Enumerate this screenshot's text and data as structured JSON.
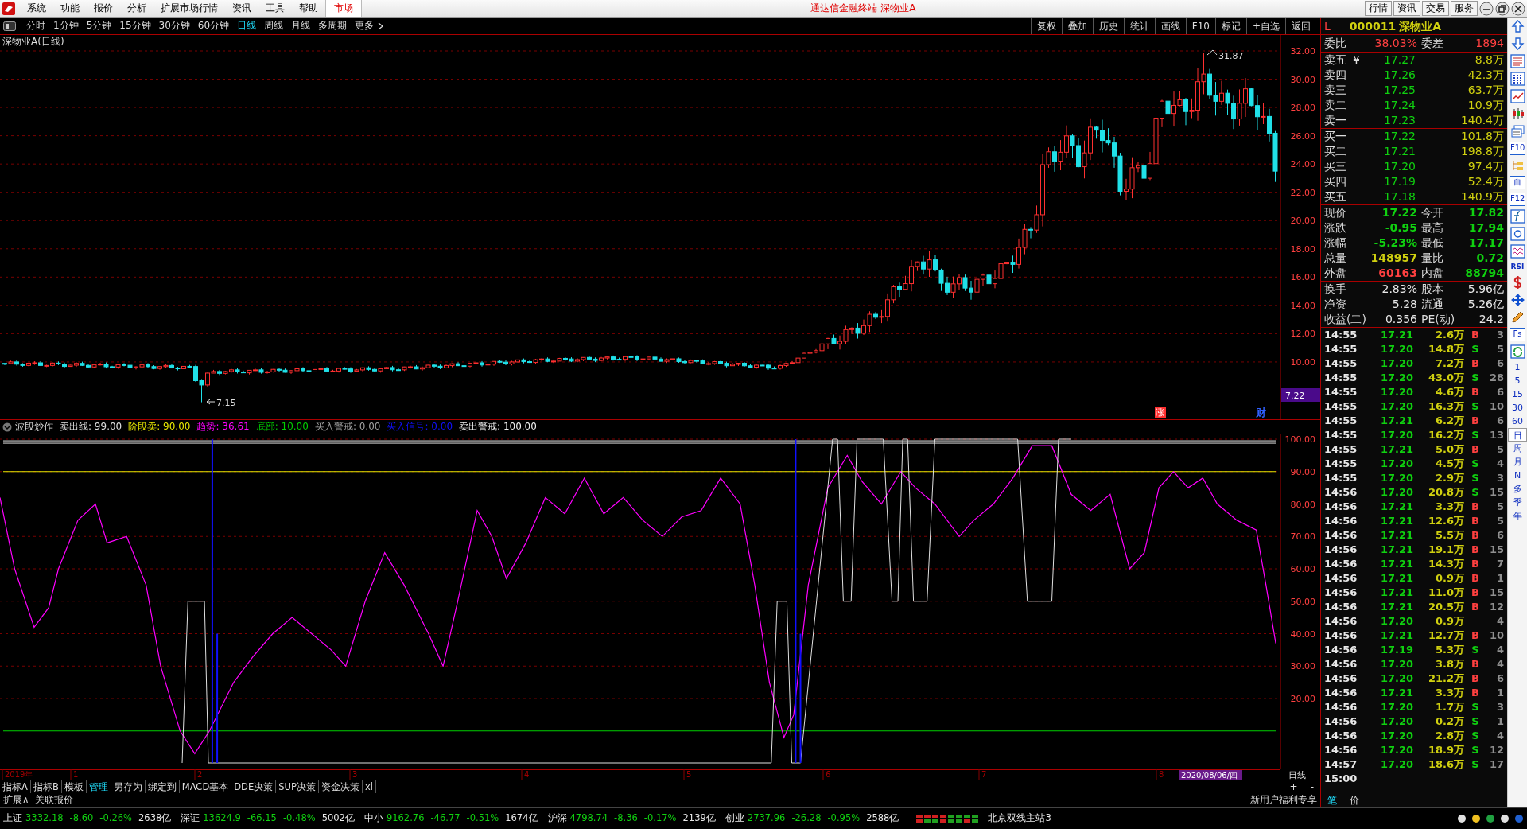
{
  "menu": [
    "系统",
    "功能",
    "报价",
    "分析",
    "扩展市场行情",
    "资讯",
    "工具",
    "帮助"
  ],
  "market_tab": "市场",
  "window_title": "通达信金融终端  深物业A",
  "top_buttons": [
    "行情",
    "资讯",
    "交易",
    "服务"
  ],
  "periods": [
    {
      "label": "分时",
      "selected": false
    },
    {
      "label": "1分钟",
      "selected": false
    },
    {
      "label": "5分钟",
      "selected": false
    },
    {
      "label": "15分钟",
      "selected": false
    },
    {
      "label": "30分钟",
      "selected": false
    },
    {
      "label": "60分钟",
      "selected": false
    },
    {
      "label": "日线",
      "selected": true
    },
    {
      "label": "周线",
      "selected": false
    },
    {
      "label": "月线",
      "selected": false
    },
    {
      "label": "多周期",
      "selected": false
    },
    {
      "label": "更多",
      "selected": false
    }
  ],
  "chart_tools": [
    "复权",
    "叠加",
    "历史",
    "统计",
    "画线",
    "F10",
    "标记",
    "+自选",
    "返回"
  ],
  "chart_title": "深物业A(日线)",
  "price_axis": [
    "32.00",
    "30.00",
    "28.00",
    "26.00",
    "24.00",
    "22.00",
    "20.00",
    "18.00",
    "16.00",
    "14.00",
    "12.00",
    "10.00"
  ],
  "high_label": "31.87",
  "low_label": "7.15",
  "price_tag": "7.22",
  "chart_markers": [
    {
      "text": "涨",
      "color": "#ff3030"
    },
    {
      "text": "财",
      "color": "#3060ff"
    }
  ],
  "indicator": {
    "name": "波段炒作",
    "params": [
      {
        "label": "卖出线:",
        "value": "99.00",
        "color": "#e0e0e0"
      },
      {
        "label": "阶段卖:",
        "value": "90.00",
        "color": "#e8e800"
      },
      {
        "label": "趋势:",
        "value": "36.61",
        "color": "#ff00ff"
      },
      {
        "label": "底部:",
        "value": "10.00",
        "color": "#00d000"
      },
      {
        "label": "买入警戒:",
        "value": "0.00",
        "color": "#a0a0a0"
      },
      {
        "label": "买入信号:",
        "value": "0.00",
        "color": "#1010ff"
      },
      {
        "label": "卖出警戒:",
        "value": "100.00",
        "color": "#f0f0f0"
      }
    ],
    "axis": [
      "100.00",
      "90.00",
      "80.00",
      "70.00",
      "60.00",
      "50.00",
      "40.00",
      "30.00",
      "20.00"
    ]
  },
  "time_axis": {
    "labels": [
      "2019年",
      "1",
      "2",
      "3",
      "4",
      "5",
      "6",
      "7",
      "8"
    ],
    "date": "2020/08/06/四",
    "period": "日线"
  },
  "bottom_tabs": [
    {
      "label": "指标A",
      "selected": false
    },
    {
      "label": "指标B",
      "selected": false
    },
    {
      "label": "模板",
      "selected": false
    },
    {
      "label": "管理",
      "selected": true
    },
    {
      "label": "另存为",
      "selected": false
    },
    {
      "label": "绑定到",
      "selected": false
    },
    {
      "label": "MACD基本",
      "selected": false
    },
    {
      "label": "DDE决策",
      "selected": false
    },
    {
      "label": "SUP决策",
      "selected": false
    },
    {
      "label": "资金决策",
      "selected": false
    },
    {
      "label": "xl",
      "selected": false
    }
  ],
  "zoom_buttons": [
    "+",
    "-"
  ],
  "extra_links": [
    "扩展∧",
    "关联报价"
  ],
  "promo": "新用户福利专享",
  "detail_tabs": [
    {
      "label": "笔",
      "selected": true
    },
    {
      "label": "价",
      "selected": false
    }
  ],
  "quote": {
    "prefix": "L",
    "code": "000011",
    "name": "深物业A",
    "ratio": {
      "label": "委比",
      "value": "38.03%",
      "label2": "委差",
      "value2": "1894"
    },
    "asks": [
      {
        "label": "卖五",
        "currency": "¥",
        "price": "17.27",
        "volume": "8.8万"
      },
      {
        "label": "卖四",
        "price": "17.26",
        "volume": "42.3万"
      },
      {
        "label": "卖三",
        "price": "17.25",
        "volume": "63.7万"
      },
      {
        "label": "卖二",
        "price": "17.24",
        "volume": "10.9万"
      },
      {
        "label": "卖一",
        "price": "17.23",
        "volume": "140.4万"
      }
    ],
    "bids": [
      {
        "label": "买一",
        "price": "17.22",
        "volume": "101.8万"
      },
      {
        "label": "买二",
        "price": "17.21",
        "volume": "198.8万"
      },
      {
        "label": "买三",
        "price": "17.20",
        "volume": "97.4万"
      },
      {
        "label": "买四",
        "price": "17.19",
        "volume": "52.4万"
      },
      {
        "label": "买五",
        "price": "17.18",
        "volume": "140.9万"
      }
    ],
    "stats": [
      {
        "cells": [
          {
            "label": "现价",
            "value": "17.22",
            "color": "#10d010"
          },
          {
            "label": "今开",
            "value": "17.82",
            "color": "#10d010"
          }
        ]
      },
      {
        "cells": [
          {
            "label": "涨跌",
            "value": "-0.95",
            "color": "#10d010"
          },
          {
            "label": "最高",
            "value": "17.94",
            "color": "#10d010"
          }
        ]
      },
      {
        "cells": [
          {
            "label": "涨幅",
            "value": "-5.23%",
            "color": "#10d010"
          },
          {
            "label": "最低",
            "value": "17.17",
            "color": "#10d010"
          }
        ]
      },
      {
        "cells": [
          {
            "label": "总量",
            "value": "148957",
            "color": "#d0d010"
          },
          {
            "label": "量比",
            "value": "0.72",
            "color": "#10d010"
          }
        ]
      },
      {
        "cells": [
          {
            "label": "外盘",
            "value": "60163",
            "color": "#ff4040"
          },
          {
            "label": "内盘",
            "value": "88794",
            "color": "#10d010"
          }
        ]
      }
    ],
    "finance": [
      {
        "label": "换手",
        "value": "2.83%",
        "label2": "股本",
        "value2": "5.96亿"
      },
      {
        "label": "净资",
        "value": "5.28",
        "label2": "流通",
        "value2": "5.26亿"
      },
      {
        "label": "收益(二)",
        "value": "0.356",
        "label2": "PE(动)",
        "value2": "24.2"
      }
    ]
  },
  "trades": [
    {
      "time": "14:55",
      "price": "17.21",
      "volume": "2.6万",
      "side": "B",
      "count": "3"
    },
    {
      "time": "14:55",
      "price": "17.20",
      "volume": "14.8万",
      "side": "S",
      "count": "5"
    },
    {
      "time": "14:55",
      "price": "17.20",
      "volume": "7.2万",
      "side": "B",
      "count": "6"
    },
    {
      "time": "14:55",
      "price": "17.20",
      "volume": "43.0万",
      "side": "S",
      "count": "28"
    },
    {
      "time": "14:55",
      "price": "17.20",
      "volume": "4.6万",
      "side": "B",
      "count": "6"
    },
    {
      "time": "14:55",
      "price": "17.20",
      "volume": "16.3万",
      "side": "S",
      "count": "10"
    },
    {
      "time": "14:55",
      "price": "17.21",
      "volume": "6.2万",
      "side": "B",
      "count": "6"
    },
    {
      "time": "14:55",
      "price": "17.20",
      "volume": "16.2万",
      "side": "S",
      "count": "13"
    },
    {
      "time": "14:55",
      "price": "17.21",
      "volume": "5.0万",
      "side": "B",
      "count": "5"
    },
    {
      "time": "14:55",
      "price": "17.20",
      "volume": "4.5万",
      "side": "S",
      "count": "4"
    },
    {
      "time": "14:55",
      "price": "17.20",
      "volume": "2.9万",
      "side": "S",
      "count": "3"
    },
    {
      "time": "14:56",
      "price": "17.20",
      "volume": "20.8万",
      "side": "S",
      "count": "15"
    },
    {
      "time": "14:56",
      "price": "17.21",
      "volume": "3.3万",
      "side": "B",
      "count": "5"
    },
    {
      "time": "14:56",
      "price": "17.21",
      "volume": "12.6万",
      "side": "B",
      "count": "5"
    },
    {
      "time": "14:56",
      "price": "17.21",
      "volume": "5.5万",
      "side": "B",
      "count": "6"
    },
    {
      "time": "14:56",
      "price": "17.21",
      "volume": "19.1万",
      "side": "B",
      "count": "15"
    },
    {
      "time": "14:56",
      "price": "17.21",
      "volume": "14.3万",
      "side": "B",
      "count": "7"
    },
    {
      "time": "14:56",
      "price": "17.21",
      "volume": "0.9万",
      "side": "B",
      "count": "1"
    },
    {
      "time": "14:56",
      "price": "17.21",
      "volume": "11.0万",
      "side": "B",
      "count": "15"
    },
    {
      "time": "14:56",
      "price": "17.21",
      "volume": "20.5万",
      "side": "B",
      "count": "12"
    },
    {
      "time": "14:56",
      "price": "17.20",
      "volume": "0.9万",
      "count": "4"
    },
    {
      "time": "14:56",
      "price": "17.21",
      "volume": "12.7万",
      "side": "B",
      "count": "10"
    },
    {
      "time": "14:56",
      "price": "17.19",
      "volume": "5.3万",
      "side": "S",
      "count": "4"
    },
    {
      "time": "14:56",
      "price": "17.20",
      "volume": "3.8万",
      "side": "B",
      "count": "4"
    },
    {
      "time": "14:56",
      "price": "17.20",
      "volume": "21.2万",
      "side": "B",
      "count": "6"
    },
    {
      "time": "14:56",
      "price": "17.21",
      "volume": "3.3万",
      "side": "B",
      "count": "1"
    },
    {
      "time": "14:56",
      "price": "17.20",
      "volume": "1.7万",
      "side": "S",
      "count": "3"
    },
    {
      "time": "14:56",
      "price": "17.20",
      "volume": "0.2万",
      "side": "S",
      "count": "1"
    },
    {
      "time": "14:56",
      "price": "17.20",
      "volume": "2.8万",
      "side": "S",
      "count": "4"
    },
    {
      "time": "14:56",
      "price": "17.20",
      "volume": "18.9万",
      "side": "S",
      "count": "12"
    },
    {
      "time": "14:57",
      "price": "17.20",
      "volume": "18.6万",
      "side": "S",
      "count": "17"
    },
    {
      "time": "15:00"
    }
  ],
  "side_strip": {
    "boxed": [
      "F10",
      "自",
      "F12",
      "Fs"
    ],
    "text_icon": "RSI",
    "periods": [
      {
        "label": "1",
        "selected": false
      },
      {
        "label": "5",
        "selected": false
      },
      {
        "label": "15",
        "selected": false
      },
      {
        "label": "30",
        "selected": false
      },
      {
        "label": "60",
        "selected": false
      },
      {
        "label": "日",
        "selected": true
      },
      {
        "label": "周",
        "selected": false
      },
      {
        "label": "月",
        "selected": false
      },
      {
        "label": "N",
        "selected": false
      },
      {
        "label": "多",
        "selected": false
      },
      {
        "label": "季",
        "selected": false
      },
      {
        "label": "年",
        "selected": false
      }
    ]
  },
  "indices": [
    {
      "name": "上证",
      "value": "3332.18",
      "change": "-8.60",
      "pct": "-0.26%",
      "amount": "2638亿"
    },
    {
      "name": "深证",
      "value": "13624.9",
      "change": "-66.15",
      "pct": "-0.48%",
      "amount": "5002亿"
    },
    {
      "name": "中小",
      "value": "9162.76",
      "change": "-46.77",
      "pct": "-0.51%",
      "amount": "1674亿"
    },
    {
      "name": "沪深",
      "value": "4798.74",
      "change": "-8.36",
      "pct": "-0.17%",
      "amount": "2139亿"
    },
    {
      "name": "创业",
      "value": "2737.96",
      "change": "-26.28",
      "pct": "-0.95%",
      "amount": "2588亿"
    }
  ],
  "server": "北京双线主站3"
}
